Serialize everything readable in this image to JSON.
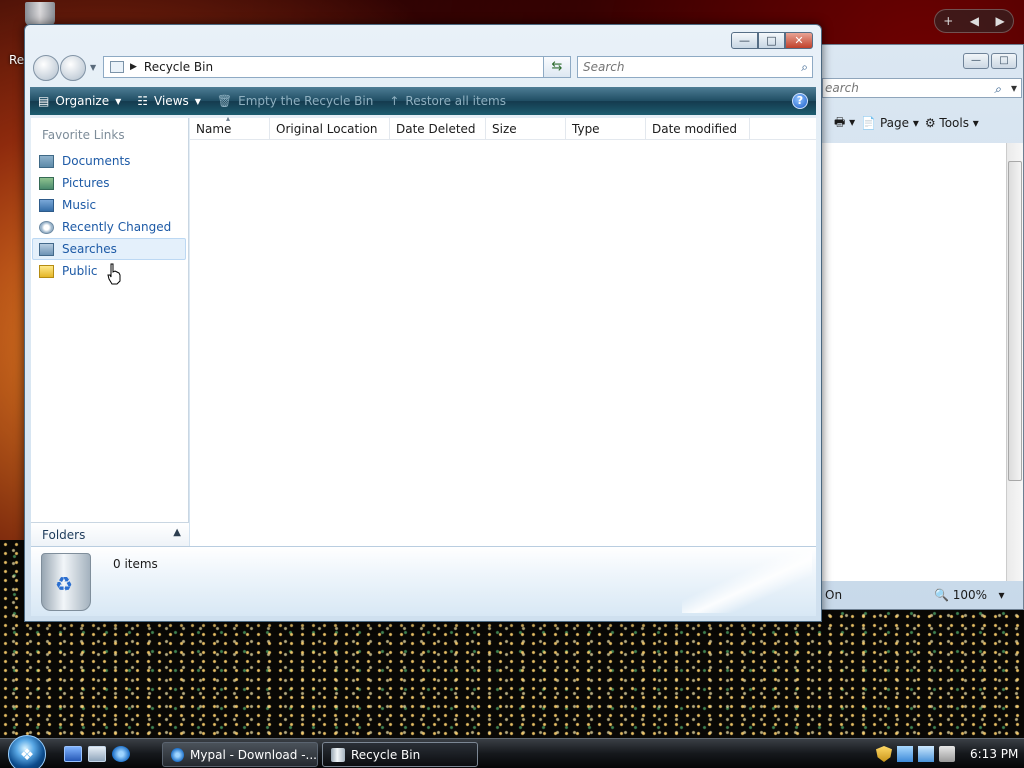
{
  "desktop": {
    "recycle_label": "Re"
  },
  "gadget": {
    "add": "+",
    "prev": "◀",
    "next": "▶"
  },
  "explorer": {
    "address": {
      "crumb": "Recycle Bin"
    },
    "search": {
      "placeholder": "Search"
    },
    "toolbar": {
      "organize": "Organize",
      "views": "Views",
      "empty": "Empty the Recycle Bin",
      "restore": "Restore all items",
      "help": "?"
    },
    "favorites": {
      "title": "Favorite Links",
      "items": [
        {
          "label": "Documents"
        },
        {
          "label": "Pictures"
        },
        {
          "label": "Music"
        },
        {
          "label": "Recently Changed"
        },
        {
          "label": "Searches"
        },
        {
          "label": "Public"
        }
      ]
    },
    "folders_label": "Folders",
    "columns": [
      {
        "label": "Name"
      },
      {
        "label": "Original Location"
      },
      {
        "label": "Date Deleted"
      },
      {
        "label": "Size"
      },
      {
        "label": "Type"
      },
      {
        "label": "Date modified"
      }
    ],
    "details": {
      "count": "0 items"
    }
  },
  "ie": {
    "search_placeholder": "earch",
    "page": "Page",
    "tools": "Tools",
    "status_left": "On",
    "zoom": "100%"
  },
  "taskbar": {
    "tasks": [
      {
        "label": "Mypal - Download -..."
      },
      {
        "label": "Recycle Bin"
      }
    ],
    "clock": "6:13 PM"
  },
  "colors": {
    "link_blue": "#1d5aa6",
    "toolbar_dark": "#1f4d63",
    "close_red": "#c0412c"
  }
}
